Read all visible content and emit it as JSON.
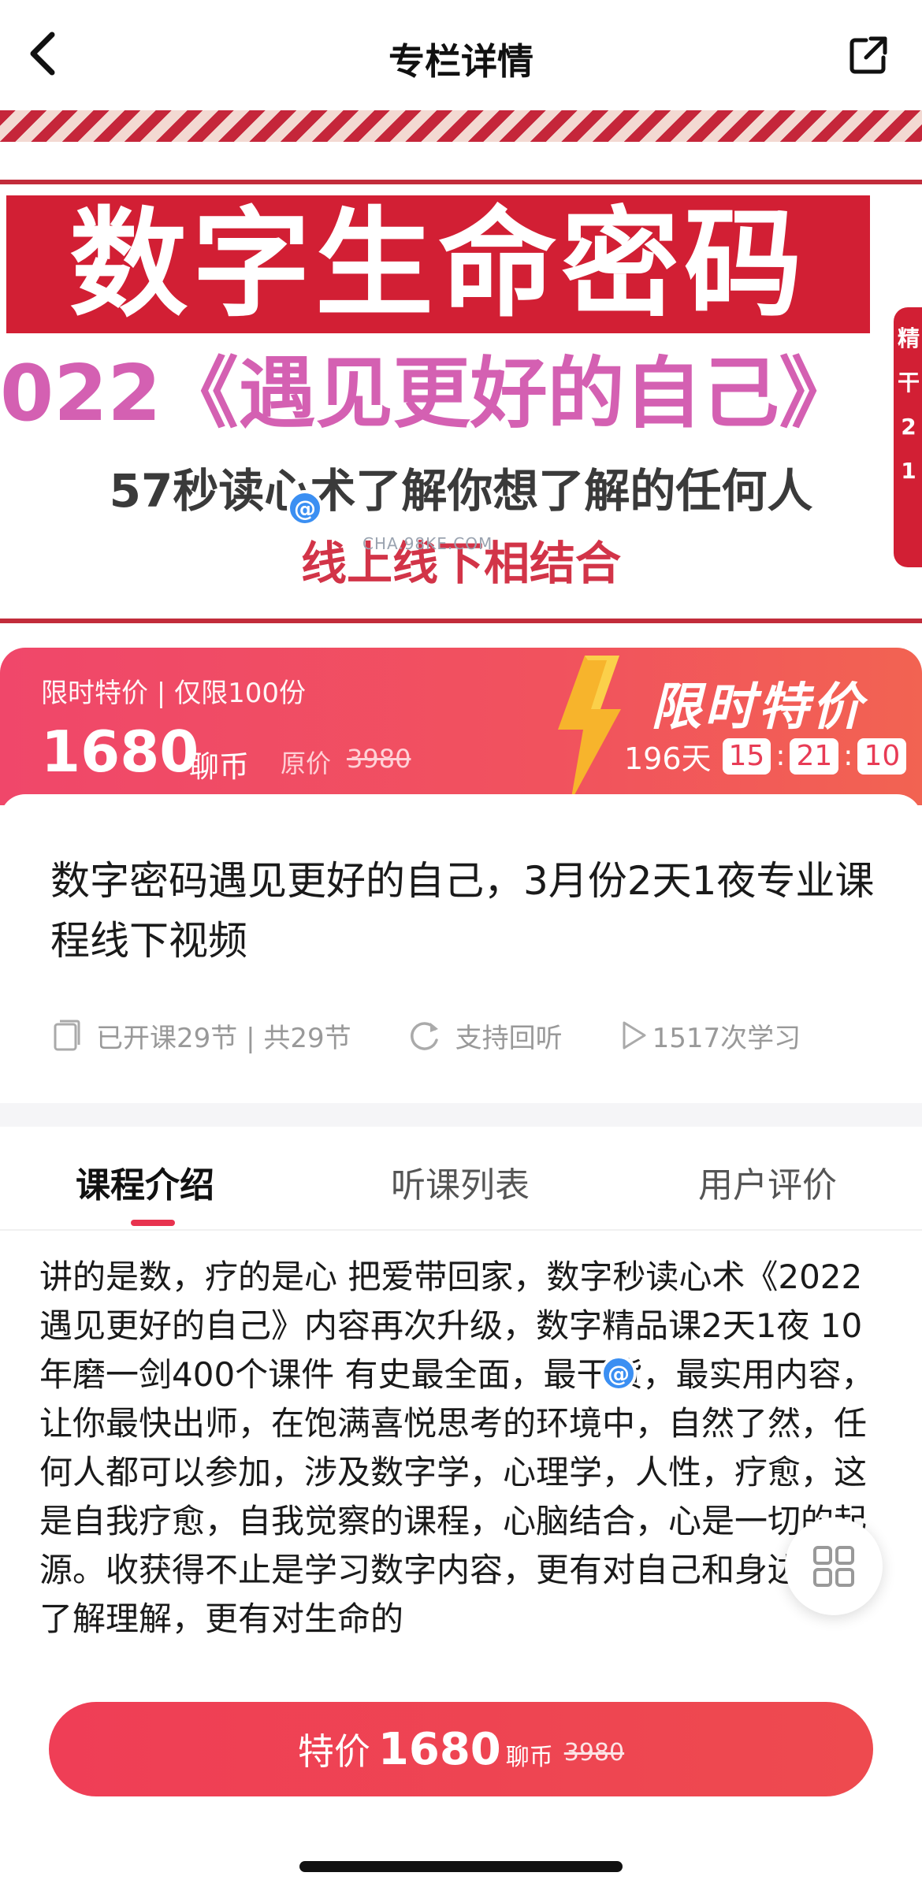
{
  "nav": {
    "title": "专栏详情"
  },
  "banner": {
    "main_title": "数字生命密码",
    "subtitle": "022《遇见更好的自己》",
    "line2": "57秒读心术了解你想了解的任何人",
    "line3": "线上线下相结合",
    "side_tag": "精\n干\n2\n1",
    "watermark_text": "CHA.98KE.COM"
  },
  "price_banner": {
    "limit_text": "限时特价 | 仅限100份",
    "price": "1680",
    "unit": "聊币",
    "original_label": "原价",
    "original_price": "3980",
    "sale_badge": "限时特价",
    "countdown": {
      "days": "196天",
      "hours": "15",
      "minutes": "21",
      "seconds": "10"
    }
  },
  "course": {
    "title": "数字密码遇见更好的自己，3月份2天1夜专业课程线下视频",
    "lessons": "已开课29节 | 共29节",
    "replay": "支持回听",
    "learners": "1517次学习"
  },
  "tabs": [
    {
      "label": "课程介绍",
      "active": true
    },
    {
      "label": "听课列表",
      "active": false
    },
    {
      "label": "用户评价",
      "active": false
    }
  ],
  "content": {
    "text": "讲的是数，疗的是心 把爱带回家，数字秒读心术《2022遇见更好的自己》内容再次升级，数字精品课2天1夜 10年磨一剑400个课件 有史最全面，最干货，最实用内容，让你最快出师，在饱满喜悦思考的环境中，自然了然，任何人都可以参加，涉及数字学，心理学，人性，疗愈，这是自我疗愈，自我觉察的课程，心脑结合，心是一切的起源。收获得不止是学习数字内容，更有对自己和身边人的了解理解，更有对生命的"
  },
  "buy_button": {
    "prefix": "特价",
    "price": "1680",
    "unit": "聊币",
    "original_price": "3980"
  },
  "colors": {
    "accent": "#e8334f",
    "banner_red": "#d21f34",
    "banner_pink": "#d460b2"
  }
}
